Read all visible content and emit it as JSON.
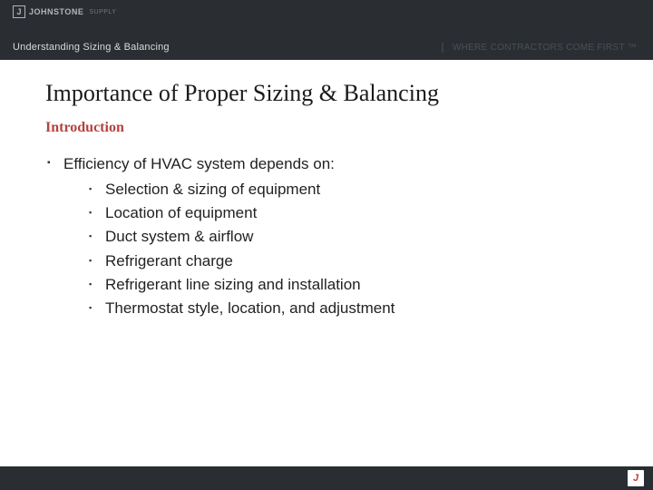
{
  "header": {
    "logo_brand": "JOHNSTONE",
    "logo_sub": "SUPPLY",
    "breadcrumb": "Understanding Sizing & Balancing",
    "tagline": "WHERE CONTRACTORS COME FIRST ™"
  },
  "content": {
    "title": "Importance of Proper Sizing & Balancing",
    "subtitle": "Introduction",
    "bullet_lead": "Efficiency of HVAC system depends on:",
    "sub_bullets": [
      "Selection & sizing of equipment",
      "Location of equipment",
      "Duct system & airflow",
      "Refrigerant charge",
      "Refrigerant line sizing and installation",
      "Thermostat style, location, and adjustment"
    ]
  },
  "footer": {
    "logo_glyph": "J"
  }
}
